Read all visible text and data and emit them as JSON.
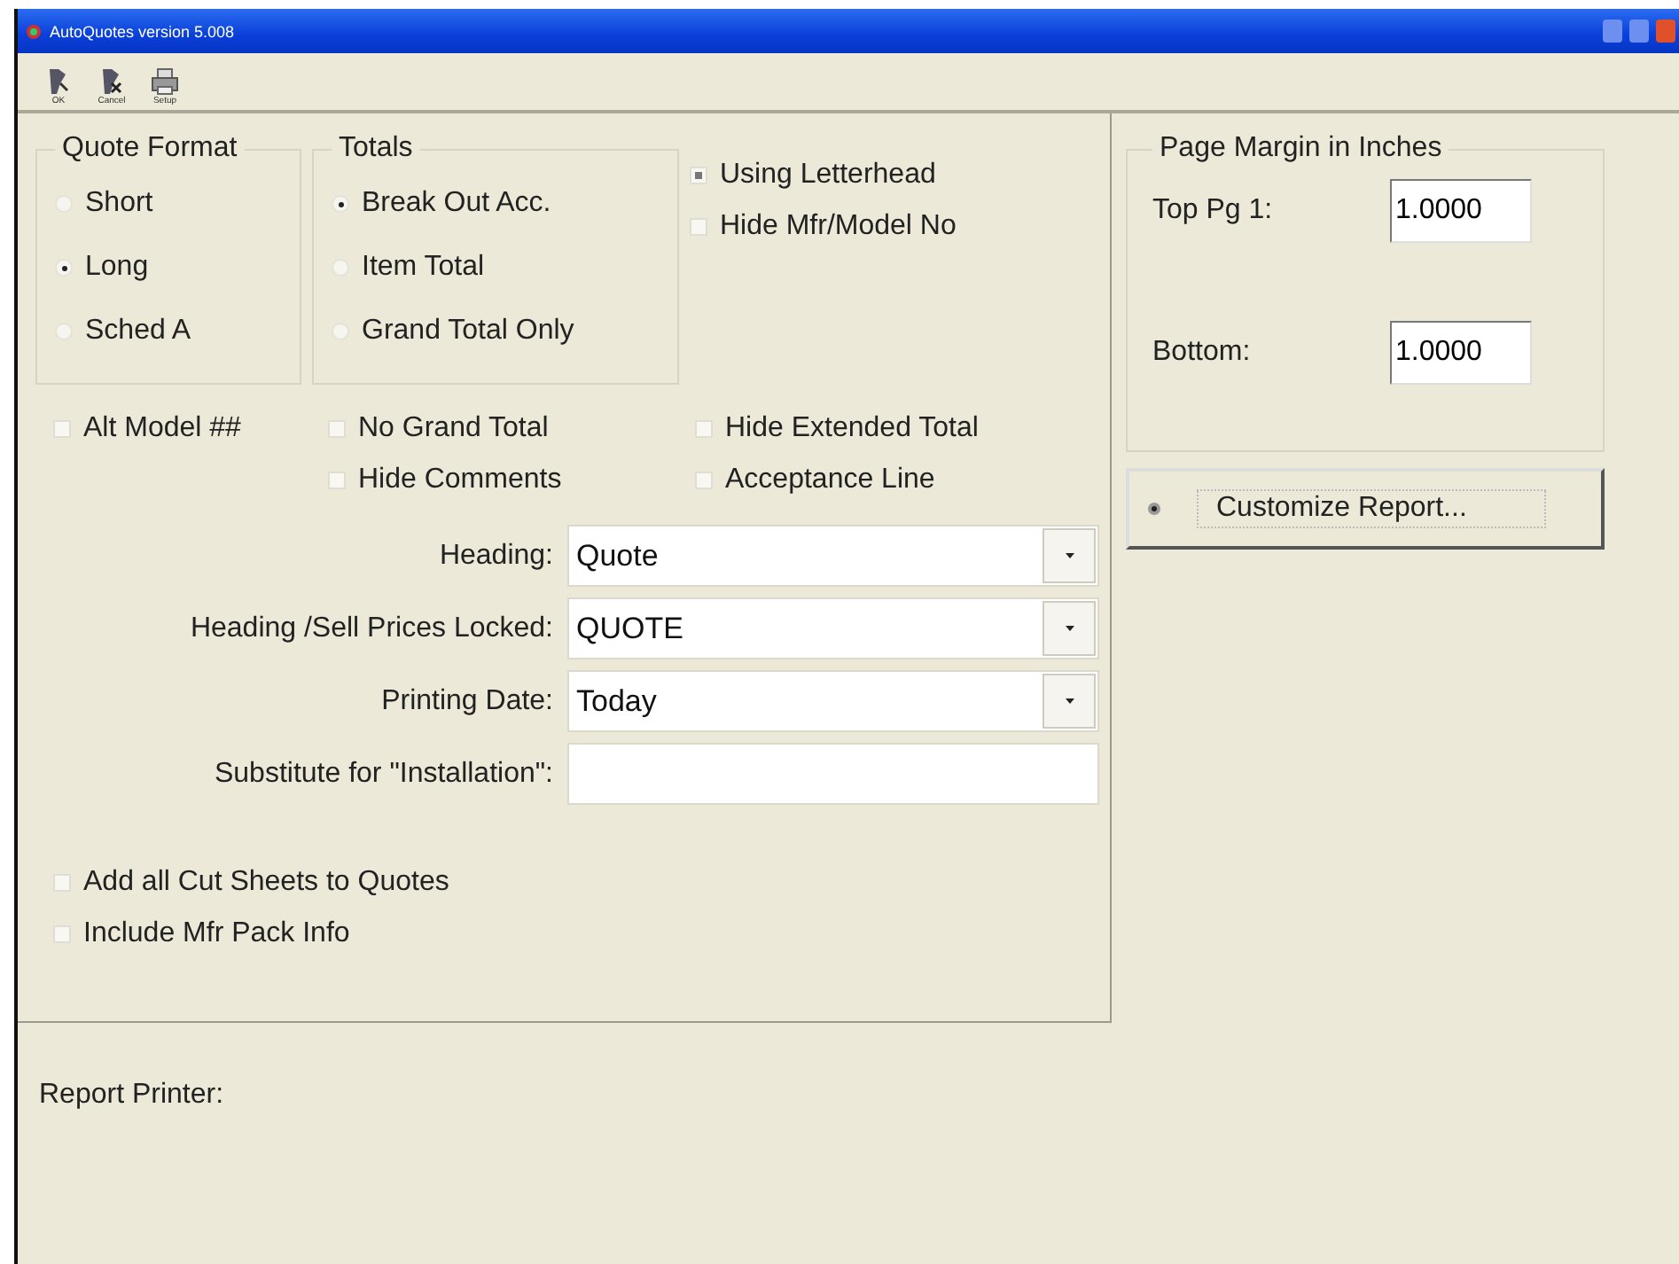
{
  "window": {
    "title": "AutoQuotes version 5.008"
  },
  "toolbar": [
    {
      "label": "OK",
      "kind": "ok"
    },
    {
      "label": "Cancel",
      "kind": "cancel"
    },
    {
      "label": "Setup",
      "kind": "printer"
    }
  ],
  "quote_format": {
    "title": "Quote Format",
    "options": [
      {
        "label": "Short",
        "selected": false
      },
      {
        "label": "Long",
        "selected": true
      },
      {
        "label": "Sched A",
        "selected": false
      }
    ]
  },
  "totals": {
    "title": "Totals",
    "options": [
      {
        "label": "Break Out Acc.",
        "selected": true
      },
      {
        "label": "Item Total",
        "selected": false
      },
      {
        "label": "Grand Total Only",
        "selected": false
      }
    ]
  },
  "top_checkboxes": [
    {
      "label": "Using Letterhead",
      "checked": true
    },
    {
      "label": "Hide Mfr/Model No",
      "checked": false
    }
  ],
  "option_columns": [
    [
      {
        "label": "Alt Model ##",
        "checked": false
      }
    ],
    [
      {
        "label": "No Grand Total",
        "checked": false
      },
      {
        "label": "Hide Comments",
        "checked": false
      }
    ],
    [
      {
        "label": "Hide Extended Total",
        "checked": false
      },
      {
        "label": "Acceptance Line",
        "checked": false
      }
    ]
  ],
  "fields": [
    {
      "label": "Heading:",
      "value": "Quote",
      "kind": "dropdown"
    },
    {
      "label": "Heading /Sell Prices Locked:",
      "value": "QUOTE",
      "kind": "dropdown"
    },
    {
      "label": "Printing Date:",
      "value": "Today",
      "kind": "dropdown"
    },
    {
      "label": "Substitute for \"Installation\":",
      "kind": "text"
    }
  ],
  "bottom_checkboxes": [
    {
      "label": "Add all Cut Sheets to Quotes",
      "checked": false
    },
    {
      "label": "Include Mfr Pack Info",
      "checked": false
    }
  ],
  "page_margin": {
    "title": "Page Margin in Inches",
    "fields": [
      {
        "label": "Top Pg 1:",
        "value": "1.0000"
      },
      {
        "label": "Bottom:",
        "value": "1.0000"
      }
    ]
  },
  "customize_button": {
    "label": "Customize Report..."
  },
  "report_printer": {
    "label": "Report Printer:"
  }
}
